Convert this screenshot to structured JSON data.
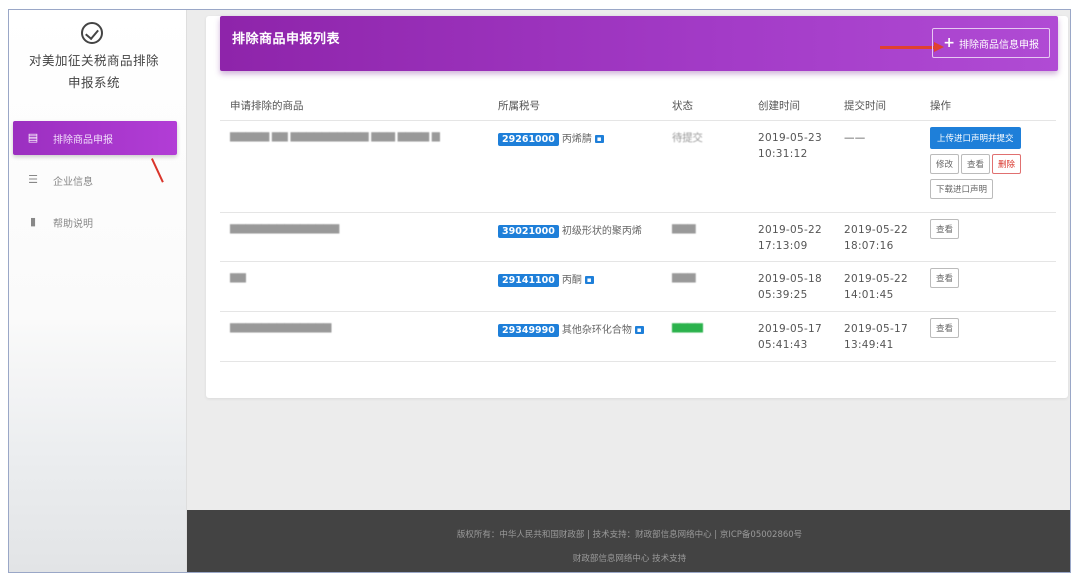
{
  "sidebar": {
    "title_line1": "对美加征关税商品排除",
    "title_line2": "申报系统",
    "items": [
      {
        "label": "排除商品申报",
        "icon": "list-card-icon",
        "active": true
      },
      {
        "label": "企业信息",
        "icon": "sliders-icon",
        "active": false
      },
      {
        "label": "帮助说明",
        "icon": "document-icon",
        "active": false
      }
    ]
  },
  "header": {
    "title": "排除商品申报列表",
    "add_button_label": "排除商品信息申报"
  },
  "table": {
    "columns": [
      "申请排除的商品",
      "所属税号",
      "状态",
      "创建时间",
      "提交时间",
      "操作"
    ],
    "rows": [
      {
        "product": "▆▆▆▆▆ ▆▆ ▆▆▆▆▆▆▆▆▆▆ ▆▆▆ ▆▆▆▆ ▆",
        "code": "29261000",
        "code_name": "丙烯腈",
        "status": "待提交",
        "status_green": false,
        "created_date": "2019-05-23",
        "created_time": "10:31:12",
        "submitted_date": "——",
        "submitted_time": "",
        "actions": [
          "上传进口声明并提交",
          "修改",
          "查看",
          "删除",
          "下载进口声明"
        ]
      },
      {
        "product": "▆▆▆▆▆▆▆▆▆▆▆▆▆▆",
        "code": "39021000",
        "code_name": "初级形状的聚丙烯",
        "status": "▆▆▆",
        "status_green": false,
        "created_date": "2019-05-22",
        "created_time": "17:13:09",
        "submitted_date": "2019-05-22",
        "submitted_time": "18:07:16",
        "actions": [
          "查看"
        ]
      },
      {
        "product": "▆▆",
        "code": "29141100",
        "code_name": "丙酮",
        "status": "▆▆▆",
        "status_green": false,
        "created_date": "2019-05-18",
        "created_time": "05:39:25",
        "submitted_date": "2019-05-22",
        "submitted_time": "14:01:45",
        "actions": [
          "查看"
        ]
      },
      {
        "product": "▆▆▆▆▆▆▆▆▆▆▆▆▆",
        "code": "29349990",
        "code_name": "其他杂环化合物",
        "status": "▆▆▆▆",
        "status_green": true,
        "created_date": "2019-05-17",
        "created_time": "05:41:43",
        "submitted_date": "2019-05-17",
        "submitted_time": "13:49:41",
        "actions": [
          "查看"
        ]
      }
    ]
  },
  "footer": {
    "line1": "版权所有：中华人民共和国财政部 | 技术支持：财政部信息网络中心 | 京ICP备05002860号",
    "line2": "财政部信息网络中心 技术支持"
  },
  "colors": {
    "accent_purple": "#9b2fc0",
    "primary_blue": "#1e7fd9",
    "danger_red": "#d9352b",
    "footer_bg": "#434343"
  }
}
